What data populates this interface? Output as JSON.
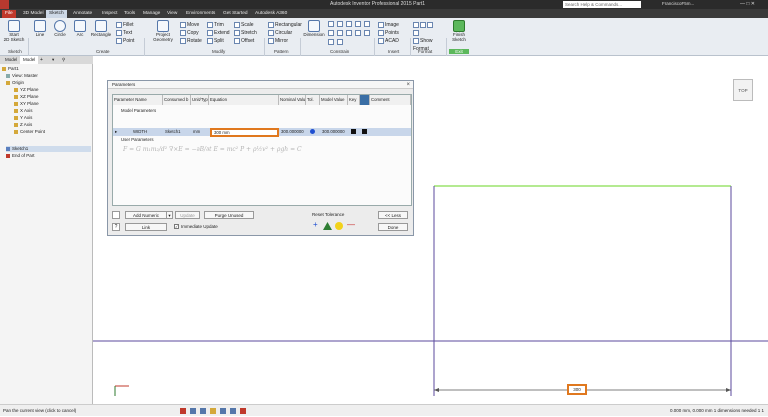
{
  "titlebar": {
    "title": "Autodesk Inventor Professional 2015   Part1",
    "search_placeholder": "Search Help & Commands...",
    "user": "FranciscoF5m..."
  },
  "tabs": [
    "File",
    "3D Model",
    "Sketch",
    "Annotate",
    "Inspect",
    "Tools",
    "Manage",
    "View",
    "Environments",
    "Get Started",
    "Autodesk A360"
  ],
  "ribbon": {
    "start_2d_sketch": "Start\n2D Sketch",
    "sketch_group": "Sketch",
    "line": "Line",
    "circle": "Circle",
    "arc": "Arc",
    "rectangle": "Rectangle",
    "fillet": "Fillet",
    "text": "Text",
    "point": "Point",
    "create_group": "Create",
    "project_geometry": "Project\nGeometry",
    "move": "Move",
    "copy": "Copy",
    "rotate": "Rotate",
    "trim": "Trim",
    "extend": "Extend",
    "split": "Split",
    "scale": "Scale",
    "stretch": "Stretch",
    "offset": "Offset",
    "modify_group": "Modify",
    "rect_pattern": "Rectangular",
    "circular": "Circular",
    "mirror": "Mirror",
    "pattern_group": "Pattern",
    "dimension": "Dimension",
    "constrain_group": "Constrain",
    "image": "Image",
    "points": "Points",
    "acad": "ACAD",
    "insert_group": "Insert",
    "show_format": "Show Format",
    "format_group": "Format",
    "finish_sketch": "Finish\nSketch",
    "exit_group": "Exit"
  },
  "browser": {
    "tab1": "Model",
    "tab2": "Model",
    "items": [
      "Part1",
      "View: Master",
      "Origin",
      "YZ Plane",
      "XZ Plane",
      "XY Plane",
      "X Axis",
      "Y Axis",
      "Z Axis",
      "Center Point",
      "Sketch1",
      "End of Part"
    ]
  },
  "viewcube": "TOP",
  "dialog": {
    "title": "Parameters",
    "columns": [
      "Parameter Name",
      "Consumed b",
      "Unit/Typ",
      "Equation",
      "Nominal Valu",
      "Tol.",
      "Model Value",
      "Key",
      "",
      "Comment"
    ],
    "model_params_label": "Model Parameters",
    "row": {
      "name": "WIDTH",
      "consumed": "Sketch1",
      "unit": "mm",
      "equation": "300 mm",
      "nominal": "300.000000",
      "model_value": "300.000000"
    },
    "user_params_label": "User Parameters",
    "formula_bg": "F = G m₁m₂/d²   ∇×E = −∂B/∂t   E = mc²   P + ρ½v² + ρgh = C",
    "add_numeric": "Add Numeric",
    "update": "Update",
    "purge_unused": "Purge Unused",
    "link": "Link",
    "immediate_update": "Immediate Update",
    "reset_tolerance": "Reset Tolerance",
    "less": "<< Less",
    "done": "Done"
  },
  "dimension_value": "300",
  "status": {
    "left": "Pan the current view (click to cancel)",
    "right": "0.000 mm, 0.000 mm   1 dimensions needed   1   1"
  },
  "colors": {
    "accent": "#e0781e",
    "sketch_line": "#5b4a9e",
    "sketch_top_line": "#9be36d"
  }
}
